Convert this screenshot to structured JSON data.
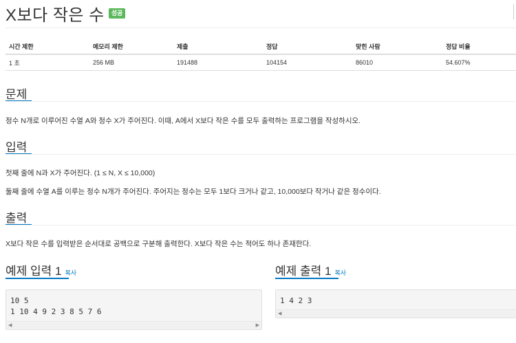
{
  "problem": {
    "title": "X보다 작은 수",
    "badge": "성공"
  },
  "stats": {
    "headers": [
      "시간 제한",
      "메모리 제한",
      "제출",
      "정답",
      "맞힌 사람",
      "정답 비율"
    ],
    "values": [
      "1 초",
      "256 MB",
      "191488",
      "104154",
      "86010",
      "54.607%"
    ]
  },
  "sections": {
    "problem_title": "문제",
    "problem_text": "정수 N개로 이루어진 수열 A와 정수 X가 주어진다. 이때, A에서 X보다 작은 수를 모두 출력하는 프로그램을 작성하시오.",
    "input_title": "입력",
    "input_line1": "첫째 줄에 N과 X가 주어진다. (1 ≤ N, X ≤ 10,000)",
    "input_line2": "둘째 줄에 수열 A를 이루는 정수 N개가 주어진다. 주어지는 정수는 모두 1보다 크거나 같고, 10,000보다 작거나 같은 정수이다.",
    "output_title": "출력",
    "output_text": "X보다 작은 수를 입력받은 순서대로 공백으로 구분해 출력한다. X보다 작은 수는 적어도 하나 존재한다."
  },
  "samples": {
    "input_title": "예제 입력 1",
    "input_copy": "복사",
    "input_text": "10 5\n1 10 4 9 2 3 8 5 7 6",
    "output_title": "예제 출력 1",
    "output_copy": "복사",
    "output_text": "1 4 2 3"
  },
  "colors": {
    "accent": "#0076c0",
    "success_badge": "#5cb85c"
  }
}
